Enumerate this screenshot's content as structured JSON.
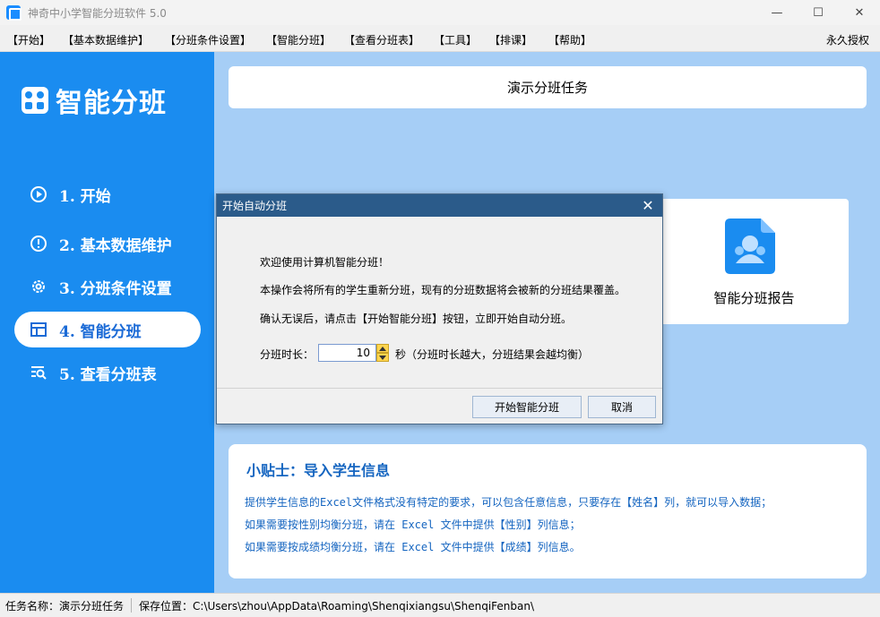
{
  "window": {
    "title": "神奇中小学智能分班软件 5.0",
    "minimize_icon": "—",
    "maximize_icon": "☐",
    "close_icon": "✕"
  },
  "menu": {
    "items": [
      "【开始】",
      "【基本数据维护】",
      "【分班条件设置】",
      "【智能分班】",
      "【查看分班表】",
      "【工具】",
      "【排课】",
      "【帮助】"
    ],
    "license": "永久授权"
  },
  "sidebar": {
    "title": "智能分班",
    "items": [
      {
        "label": "1. 开始",
        "icon": "start-icon"
      },
      {
        "label": "2. 基本数据维护",
        "icon": "data-maintenance-icon"
      },
      {
        "label": "3. 分班条件设置",
        "icon": "gear-icon"
      },
      {
        "label": "4. 智能分班",
        "icon": "table-icon",
        "active": true
      },
      {
        "label": "5. 查看分班表",
        "icon": "search-list-icon"
      }
    ]
  },
  "main": {
    "task_name": "演示分班任务",
    "report_label": "智能分班报告"
  },
  "tips": {
    "title": "小贴士：导入学生信息",
    "lines": [
      "提供学生信息的Excel文件格式没有特定的要求，可以包含任意信息，只要存在【姓名】列，就可以导入数据；",
      "如果需要按性别均衡分班，请在 Excel 文件中提供【性别】列信息；",
      "如果需要按成绩均衡分班，请在 Excel 文件中提供【成绩】列信息。"
    ]
  },
  "dialog": {
    "title": "开始自动分班",
    "line1": "欢迎使用计算机智能分班！",
    "line2": "本操作会将所有的学生重新分班，现有的分班数据将会被新的分班结果覆盖。",
    "line3": "确认无误后，请点击【开始智能分班】按钮，立即开始自动分班。",
    "duration_label": "分班时长：",
    "duration_value": "10",
    "duration_unit": "秒（分班时长越大，分班结果会越均衡）",
    "start_button": "开始智能分班",
    "cancel_button": "取消"
  },
  "status": {
    "task_label": "任务名称：演示分班任务",
    "save_label": "保存位置：C:\\Users\\zhou\\AppData\\Roaming\\Shenqixiangsu\\ShenqiFenban\\"
  },
  "colors": {
    "sidebar_bg": "#1a8cf0",
    "main_bg": "#a6cef6",
    "dialog_title_bg": "#2b5b8a",
    "tips_text": "#1565c0"
  }
}
